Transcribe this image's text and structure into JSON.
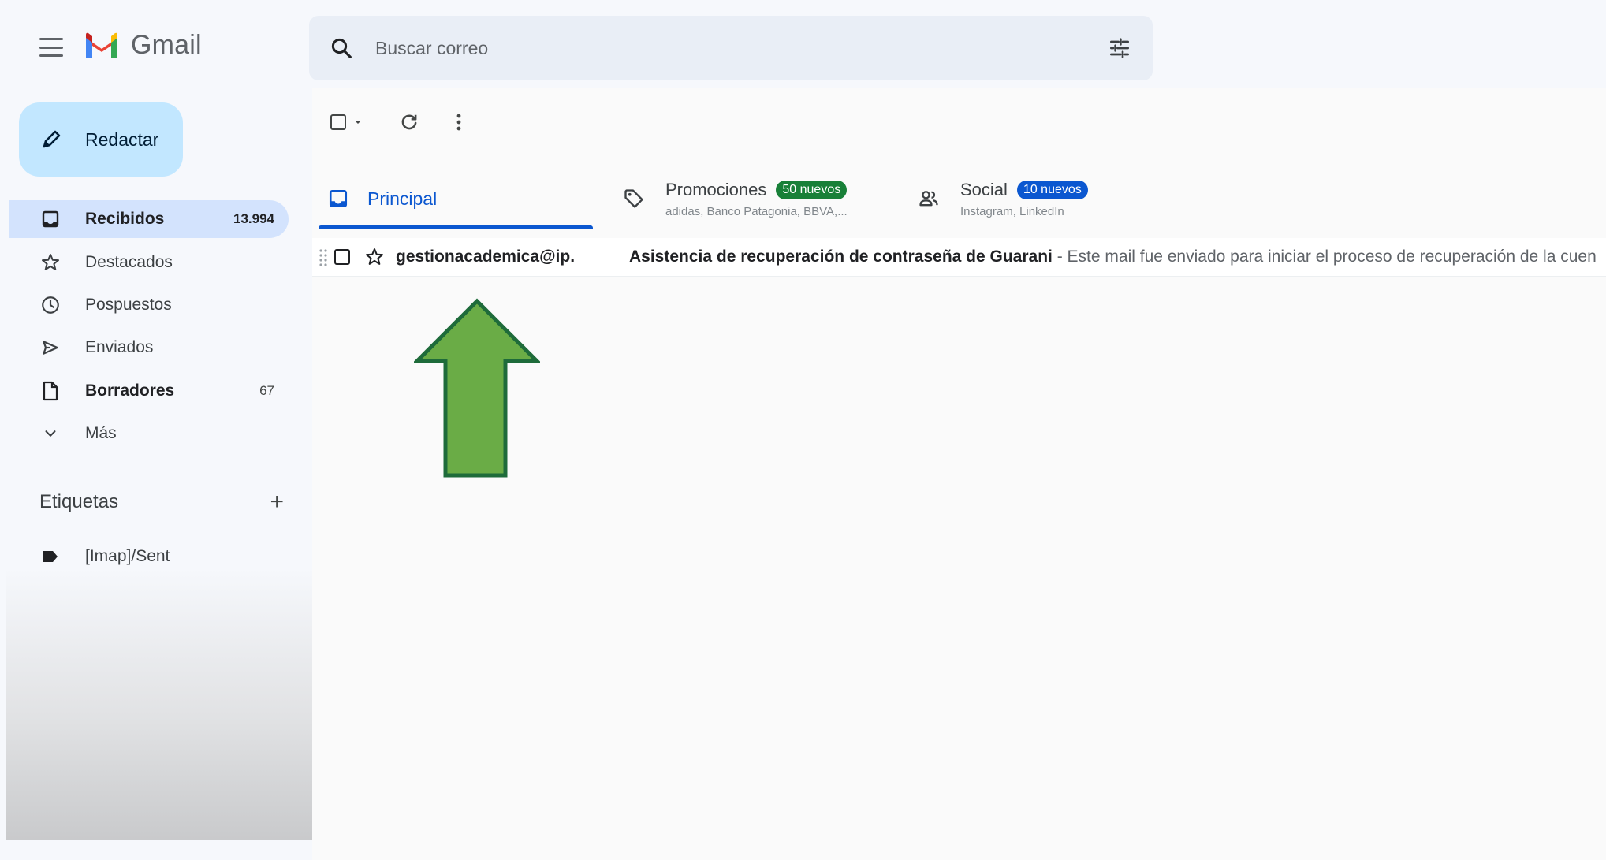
{
  "app": {
    "name": "Gmail"
  },
  "compose": {
    "label": "Redactar"
  },
  "sidebar": {
    "items": [
      {
        "label": "Recibidos",
        "count": "13.994"
      },
      {
        "label": "Destacados",
        "count": ""
      },
      {
        "label": "Pospuestos",
        "count": ""
      },
      {
        "label": "Enviados",
        "count": ""
      },
      {
        "label": "Borradores",
        "count": "67"
      },
      {
        "label": "Más",
        "count": ""
      }
    ],
    "labels_title": "Etiquetas",
    "add_label": "+",
    "labels": [
      {
        "label": "[Imap]/Sent"
      }
    ]
  },
  "search": {
    "placeholder": "Buscar correo",
    "value": ""
  },
  "tabs": [
    {
      "name": "Principal",
      "badge": "",
      "subtitle": ""
    },
    {
      "name": "Promociones",
      "badge": "50 nuevos",
      "subtitle": "adidas, Banco Patagonia, BBVA,..."
    },
    {
      "name": "Social",
      "badge": "10 nuevos",
      "subtitle": "Instagram, LinkedIn"
    }
  ],
  "emails": [
    {
      "sender": "gestionacademica@ip.",
      "subject": "Asistencia de recuperación de contraseña de Guarani",
      "snippet": " - Este mail fue enviado para iniciar el proceso de recuperación de la cuen"
    }
  ],
  "colors": {
    "accent": "#0b57d0",
    "compose_bg": "#c2e7ff",
    "active_nav": "#d3e3fd",
    "promo_badge": "#188038",
    "social_badge": "#0b57d0",
    "arrow_fill": "#6aac46",
    "arrow_stroke": "#1e6b3a"
  },
  "icons": {
    "menu": "hamburger-icon",
    "search": "search-icon",
    "filters": "tune-icon",
    "compose": "pencil-icon"
  }
}
